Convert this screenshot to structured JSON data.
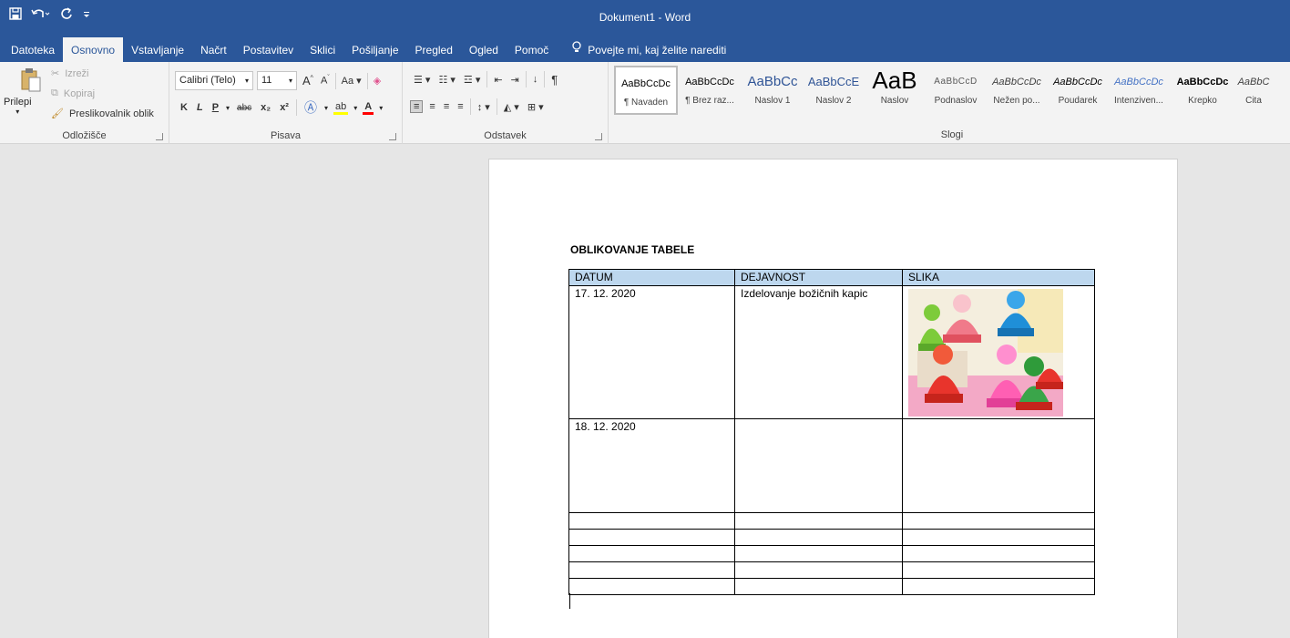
{
  "window": {
    "title": "Dokument1 - Word",
    "accent": "#2b579a"
  },
  "qat": {
    "save_icon": "save-icon",
    "undo_icon": "undo-icon",
    "redo_icon": "redo-icon",
    "customize_icon": "customize-qat-icon"
  },
  "tabs": [
    {
      "label": "Datoteka"
    },
    {
      "label": "Osnovno"
    },
    {
      "label": "Vstavljanje"
    },
    {
      "label": "Načrt"
    },
    {
      "label": "Postavitev"
    },
    {
      "label": "Sklici"
    },
    {
      "label": "Pošiljanje"
    },
    {
      "label": "Pregled"
    },
    {
      "label": "Ogled"
    },
    {
      "label": "Pomoč"
    }
  ],
  "tellme": {
    "label": "Povejte mi, kaj želite narediti"
  },
  "ribbon": {
    "clipboard": {
      "label": "Odložišče",
      "paste": "Prilepi",
      "cut": "Izreži",
      "copy": "Kopiraj",
      "format_painter": "Preslikovalnik oblik"
    },
    "font": {
      "label": "Pisava",
      "family": "Calibri (Telo)",
      "size": "11",
      "bold": "K",
      "italic": "L",
      "underline": "P",
      "strike": "abc",
      "sub": "x₂",
      "sup": "x²",
      "case": "Aa"
    },
    "paragraph": {
      "label": "Odstavek",
      "pilcrow": "¶"
    },
    "styles": {
      "label": "Slogi",
      "items": [
        {
          "preview": "AaBbCcDc",
          "name": "¶ Navaden"
        },
        {
          "preview": "AaBbCcDc",
          "name": "¶ Brez raz..."
        },
        {
          "preview": "AaBbCc",
          "name": "Naslov 1"
        },
        {
          "preview": "AaBbCcE",
          "name": "Naslov 2"
        },
        {
          "preview": "AaB",
          "name": "Naslov"
        },
        {
          "preview": "AaBbCcD",
          "name": "Podnaslov"
        },
        {
          "preview": "AaBbCcDc",
          "name": "Nežen po..."
        },
        {
          "preview": "AaBbCcDc",
          "name": "Poudarek"
        },
        {
          "preview": "AaBbCcDc",
          "name": "Intenziven..."
        },
        {
          "preview": "AaBbCcDc",
          "name": "Krepko"
        },
        {
          "preview": "AaBbC",
          "name": "Cita"
        }
      ]
    }
  },
  "document": {
    "heading": "OBLIKOVANJE TABELE",
    "header_fill": "#bdd7ee",
    "columns": [
      "DATUM",
      "DEJAVNOST",
      "SLIKA"
    ],
    "rows": [
      {
        "datum": "17. 12. 2020",
        "dejavnost": "Izdelovanje božičnih kapic"
      },
      {
        "datum": "18. 12. 2020",
        "dejavnost": ""
      }
    ]
  }
}
